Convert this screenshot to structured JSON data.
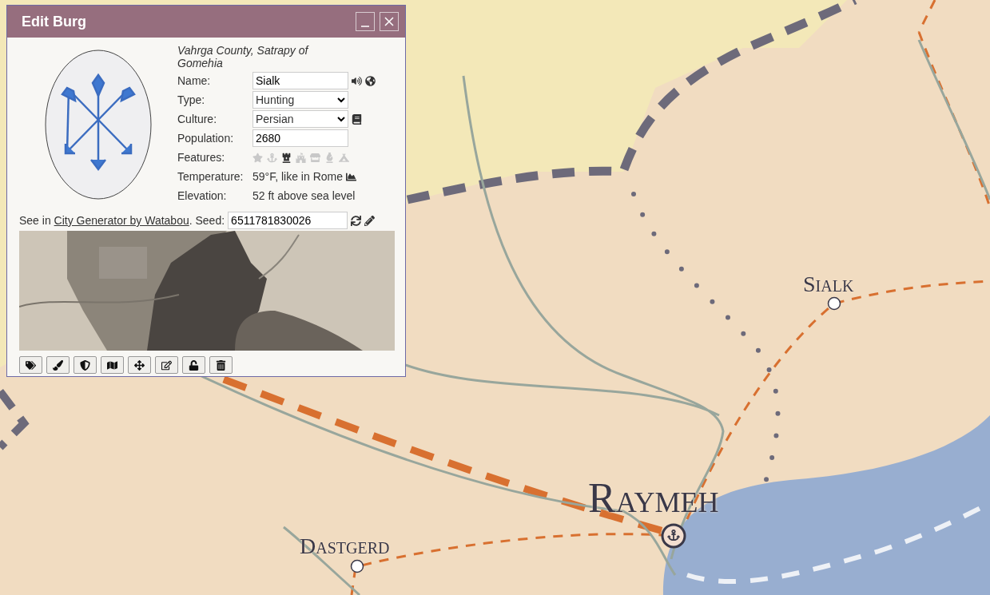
{
  "map": {
    "towns": [
      {
        "name": "Sialk",
        "kind": "town"
      },
      {
        "name": "Raymeh",
        "kind": "port"
      },
      {
        "name": "Dastgerd",
        "kind": "town"
      }
    ]
  },
  "dialog": {
    "title": "Edit Burg",
    "location": "Vahrga County, Satrapy of Gomehia",
    "fields": [
      {
        "kind": "input",
        "label": "Name:",
        "value": "Sialk"
      },
      {
        "kind": "select",
        "label": "Type:",
        "value": "Hunting"
      },
      {
        "kind": "select",
        "label": "Culture:",
        "value": "Persian"
      },
      {
        "kind": "input",
        "label": "Population:",
        "value": "2680"
      }
    ],
    "features": {
      "label": "Features:",
      "items": [
        {
          "kind": "capital",
          "on": false
        },
        {
          "kind": "port",
          "on": false
        },
        {
          "kind": "citadel",
          "on": true
        },
        {
          "kind": "walls",
          "on": false
        },
        {
          "kind": "plaza",
          "on": false
        },
        {
          "kind": "temple",
          "on": false
        },
        {
          "kind": "shanty",
          "on": false
        }
      ]
    },
    "temperature": {
      "label": "Temperature:",
      "value": "59°F, like in Rome"
    },
    "elevation": {
      "label": "Elevation:",
      "value": "52 ft above sea level"
    },
    "generator": {
      "prefix": "See in ",
      "link": "City Generator by Watabou",
      "suffix": ". Seed:",
      "seed": "6511781830026"
    },
    "toolbar": [
      {
        "kind": "tag"
      },
      {
        "kind": "brush"
      },
      {
        "kind": "shield"
      },
      {
        "kind": "map"
      },
      {
        "kind": "move"
      },
      {
        "kind": "edit"
      },
      {
        "kind": "unlock"
      },
      {
        "kind": "delete"
      }
    ]
  }
}
